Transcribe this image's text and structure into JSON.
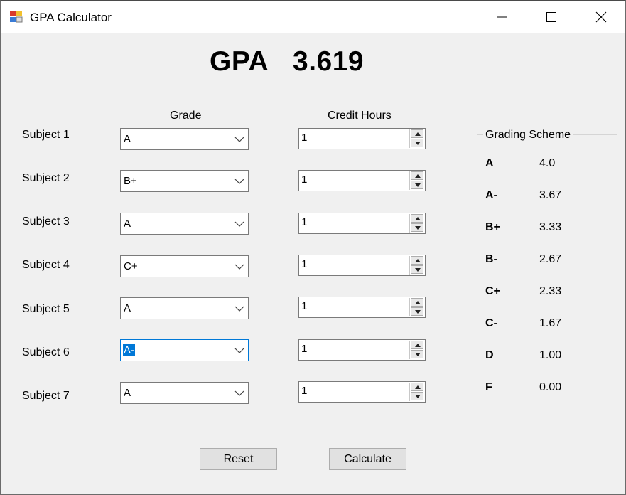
{
  "window": {
    "title": "GPA Calculator"
  },
  "gpa": {
    "label": "GPA",
    "value": "3.619"
  },
  "columns": {
    "grade": "Grade",
    "credit_hours": "Credit Hours"
  },
  "subjects": [
    {
      "label": "Subject 1",
      "grade": "A",
      "credits": "1"
    },
    {
      "label": "Subject 2",
      "grade": "B+",
      "credits": "1"
    },
    {
      "label": "Subject 3",
      "grade": "A",
      "credits": "1"
    },
    {
      "label": "Subject 4",
      "grade": "C+",
      "credits": "1"
    },
    {
      "label": "Subject 5",
      "grade": "A",
      "credits": "1"
    },
    {
      "label": "Subject 6",
      "grade": "A-",
      "credits": "1"
    },
    {
      "label": "Subject 7",
      "grade": "A",
      "credits": "1"
    }
  ],
  "grading_scheme": {
    "title": "Grading Scheme",
    "rows": [
      {
        "grade": "A",
        "points": "4.0"
      },
      {
        "grade": "A-",
        "points": "3.67"
      },
      {
        "grade": "B+",
        "points": "3.33"
      },
      {
        "grade": "B-",
        "points": "2.67"
      },
      {
        "grade": "C+",
        "points": "2.33"
      },
      {
        "grade": "C-",
        "points": "1.67"
      },
      {
        "grade": "D",
        "points": "1.00"
      },
      {
        "grade": "F",
        "points": "0.00"
      }
    ]
  },
  "buttons": {
    "reset": "Reset",
    "calculate": "Calculate"
  },
  "colors": {
    "focus_accent": "#0078d7",
    "window_bg": "#f0f0f0"
  },
  "icons": {
    "app": "app-icon",
    "minimize": "minimize-icon",
    "maximize": "maximize-icon",
    "close": "close-icon"
  }
}
